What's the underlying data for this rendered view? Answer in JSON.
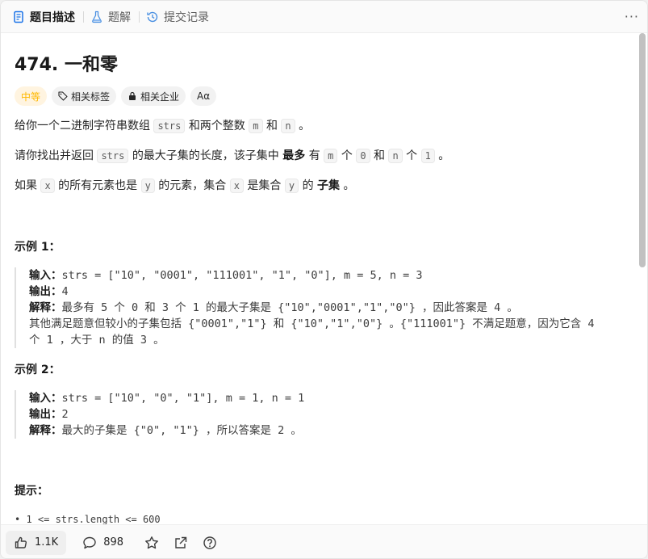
{
  "tabs": [
    {
      "label": "题目描述"
    },
    {
      "label": "题解"
    },
    {
      "label": "提交记录"
    }
  ],
  "more_label": "···",
  "problem": {
    "title": "474. 一和零",
    "tags": {
      "difficulty": "中等",
      "topics": "相关标签",
      "companies": "相关企业",
      "font": "Aα"
    },
    "p1": {
      "a": "给你一个二进制字符串数组",
      "code1": "strs",
      "b": "和两个整数",
      "code2": "m",
      "c": "和",
      "code3": "n",
      "d": "。"
    },
    "p2": {
      "a": "请你找出并返回",
      "code1": "strs",
      "b": "的最大子集的长度，该子集中",
      "strong": "最多",
      "c": "有",
      "code2": "m",
      "d": "个",
      "code3": "0",
      "e": "和",
      "code4": "n",
      "f": "个",
      "code5": "1",
      "g": "。"
    },
    "p3": {
      "a": "如果",
      "code1": "x",
      "b": "的所有元素也是",
      "code2": "y",
      "c": "的元素，集合",
      "code3": "x",
      "d": "是集合",
      "code4": "y",
      "e": "的",
      "strong": "子集",
      "f": "。"
    }
  },
  "examples": [
    {
      "heading": "示例 1：",
      "input_key": "输入：",
      "input_val": "strs = [\"10\", \"0001\", \"111001\", \"1\", \"0\"], m = 5, n = 3",
      "output_key": "输出：",
      "output_val": "4",
      "explain_key": "解释：",
      "explain_val": "最多有 5 个 0 和 3 个 1 的最大子集是 {\"10\",\"0001\",\"1\",\"0\"} ，因此答案是 4 。",
      "explain_l2": "其他满足题意但较小的子集包括 {\"0001\",\"1\"} 和 {\"10\",\"1\",\"0\"} 。{\"111001\"} 不满足题意，因为它含 4",
      "explain_l3": "个 1 ，大于 n 的值 3 。"
    },
    {
      "heading": "示例 2：",
      "input_key": "输入：",
      "input_val": "strs = [\"10\", \"0\", \"1\"], m = 1, n = 1",
      "output_key": "输出：",
      "output_val": "2",
      "explain_key": "解释：",
      "explain_val": "最大的子集是 {\"0\", \"1\"} ，所以答案是 2 。"
    }
  ],
  "hints_heading": "提示：",
  "hint_partial": "• 1 <= strs.length <= 600",
  "bottom": {
    "likes": "1.1K",
    "comments": "898"
  },
  "colors": {
    "accent": "#ffb800",
    "text": "#262626",
    "muted": "#5c5c5c"
  }
}
